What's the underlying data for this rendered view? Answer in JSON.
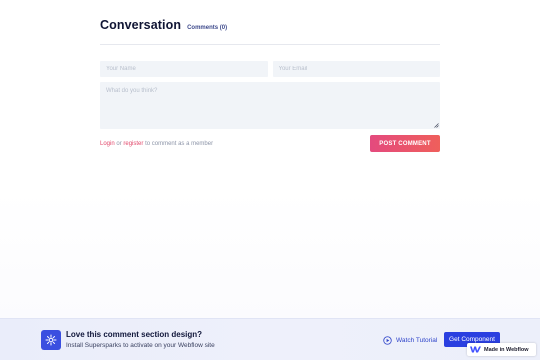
{
  "conversation": {
    "title": "Conversation",
    "count_label": "Comments (0)"
  },
  "form": {
    "name_placeholder": "Your Name",
    "email_placeholder": "Your Email",
    "comment_placeholder": "What do you think?",
    "login_label": "Login",
    "or_label": "or",
    "register_label": "register",
    "member_note": "to comment as a member",
    "post_label": "POST COMMENT"
  },
  "banner": {
    "title": "Love this comment section design?",
    "subtitle": "Install Supersparks to activate on your Webflow site",
    "watch_label": "Watch Tutorial",
    "get_label": "Get Component"
  },
  "badge": {
    "label": "Made in Webflow"
  },
  "colors": {
    "accent_pink": "#e44a7e",
    "accent_coral": "#ef5f5b",
    "brand_blue": "#2a3fe0"
  },
  "icons": {
    "banner": "sparkle-icon",
    "watch": "play-circle-icon",
    "badge": "webflow-logo-icon"
  }
}
